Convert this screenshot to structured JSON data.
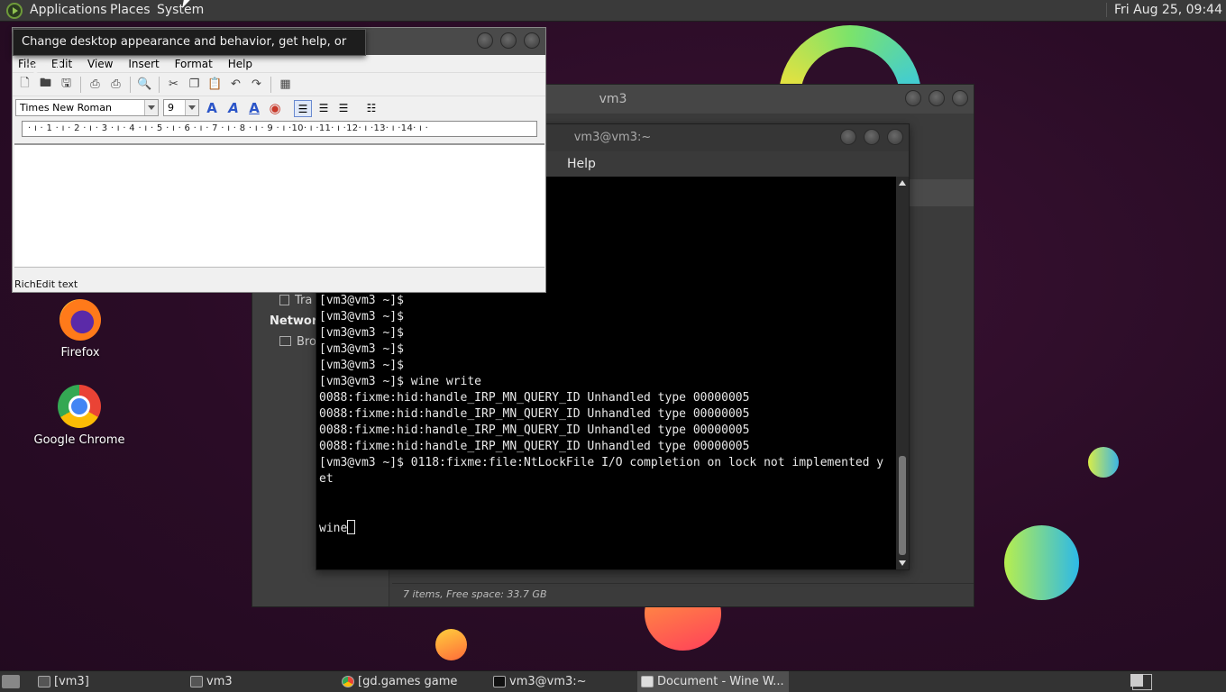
{
  "top_panel": {
    "menus": [
      "Applications",
      "Places",
      "System"
    ],
    "clock": "Fri Aug 25, 09:44"
  },
  "tooltip": "Change desktop appearance and behavior, get help, or log out",
  "desktop_icons": [
    {
      "label": "Firefox",
      "icon": "firefox-icon"
    },
    {
      "label": "Google Chrome",
      "icon": "chrome-icon"
    }
  ],
  "file_manager": {
    "title": "vm3",
    "sidebar": {
      "trash": "Tra",
      "network_header": "Network",
      "browse": "Bro"
    },
    "status": "7 items, Free space: 33.7 GB"
  },
  "terminal": {
    "title": "vm3@vm3:~",
    "menu": [
      "Help"
    ],
    "lines": [
      "[vm3@vm3 ~]$",
      "[vm3@vm3 ~]$",
      "[vm3@vm3 ~]$",
      "[vm3@vm3 ~]$",
      "[vm3@vm3 ~]$",
      "[vm3@vm3 ~]$",
      "[vm3@vm3 ~]$",
      "[vm3@vm3 ~]$",
      "[vm3@vm3 ~]$",
      "[vm3@vm3 ~]$ wine write",
      "0088:fixme:hid:handle_IRP_MN_QUERY_ID Unhandled type 00000005",
      "0088:fixme:hid:handle_IRP_MN_QUERY_ID Unhandled type 00000005",
      "0088:fixme:hid:handle_IRP_MN_QUERY_ID Unhandled type 00000005",
      "0088:fixme:hid:handle_IRP_MN_QUERY_ID Unhandled type 00000005",
      "[vm3@vm3 ~]$ 0118:fixme:file:NtLockFile I/O completion on lock not implemented y",
      "et"
    ],
    "current_input": "wine"
  },
  "wordpad": {
    "menu": [
      "File",
      "Edit",
      "View",
      "Insert",
      "Format",
      "Help"
    ],
    "font": "Times New Roman",
    "font_size": "9",
    "ruler": "· ı · 1 · ı · 2 · ı · 3 · ı · 4 · ı · 5 · ı · 6 · ı · 7 · ı · 8 · ı · 9 · ı ·10· ı ·11· ı ·12· ı ·13· ı ·14· ı ·",
    "status": "RichEdit text"
  },
  "taskbar": {
    "tasks": [
      {
        "label": "[vm3]",
        "icon": "folder-icon",
        "active": false
      },
      {
        "label": "vm3",
        "icon": "folder-icon",
        "active": false
      },
      {
        "label": "[gd.games game bu...",
        "icon": "chrome-icon",
        "active": false
      },
      {
        "label": "vm3@vm3:~",
        "icon": "terminal-icon",
        "active": false
      },
      {
        "label": "Document - Wine W...",
        "icon": "wordpad-icon",
        "active": true
      }
    ]
  },
  "colors": {
    "desktop_bg": "#2b0d26",
    "panel_bg": "#3a3a3a",
    "terminal_bg": "#000000",
    "terminal_fg": "#e8e8e8"
  }
}
